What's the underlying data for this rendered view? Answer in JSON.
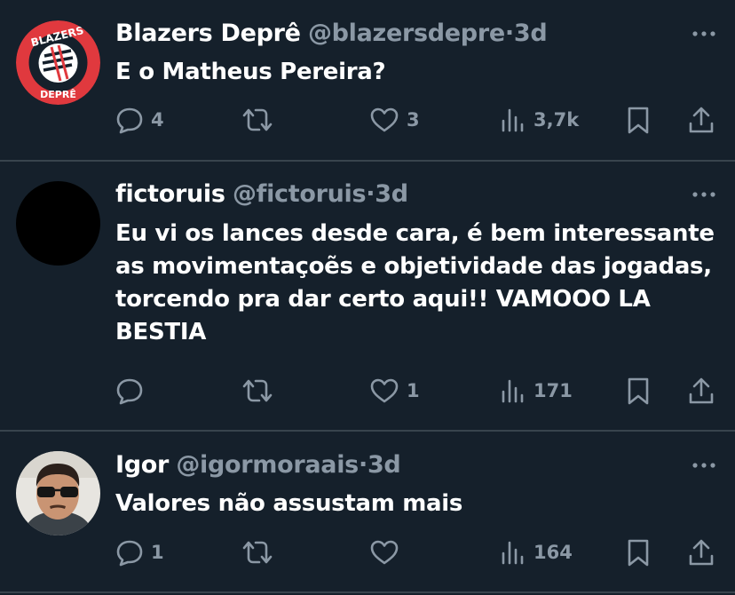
{
  "tweets": [
    {
      "name": "Blazers Deprê",
      "handle": "@blazersdepre",
      "separator": "·",
      "time": "3d",
      "text": "E o Matheus Pereira?",
      "avatar": {
        "type": "logo",
        "top_text": "BLAZERS",
        "bottom_text": "DEPRÊ",
        "color": "#e0393e"
      },
      "replies": "4",
      "retweets": "",
      "likes": "3",
      "views": "3,7k"
    },
    {
      "name": "fictoruis",
      "handle": "@fictoruis",
      "separator": "·",
      "time": "3d",
      "text": "Eu vi os lances desde cara, é bem interessante as movimentaçoẽs e objetividade das jogadas, torcendo pra dar certo aqui!! VAMOOO LA BESTIA",
      "avatar": {
        "type": "black-circle",
        "color": "#000000"
      },
      "replies": "",
      "retweets": "",
      "likes": "1",
      "views": "171"
    },
    {
      "name": "Igor",
      "handle": "@igormoraais",
      "separator": "·",
      "time": "3d",
      "text": "Valores não assustam mais",
      "avatar": {
        "type": "photo"
      },
      "replies": "1",
      "retweets": "",
      "likes": "",
      "views": "164"
    }
  ],
  "colors": {
    "background": "#15202b",
    "divider": "#38444d",
    "primary_text": "#ffffff",
    "secondary_text": "#8b98a5"
  },
  "icons": [
    "reply-icon",
    "retweet-icon",
    "like-icon",
    "views-icon",
    "bookmark-icon",
    "share-icon",
    "more-icon"
  ]
}
